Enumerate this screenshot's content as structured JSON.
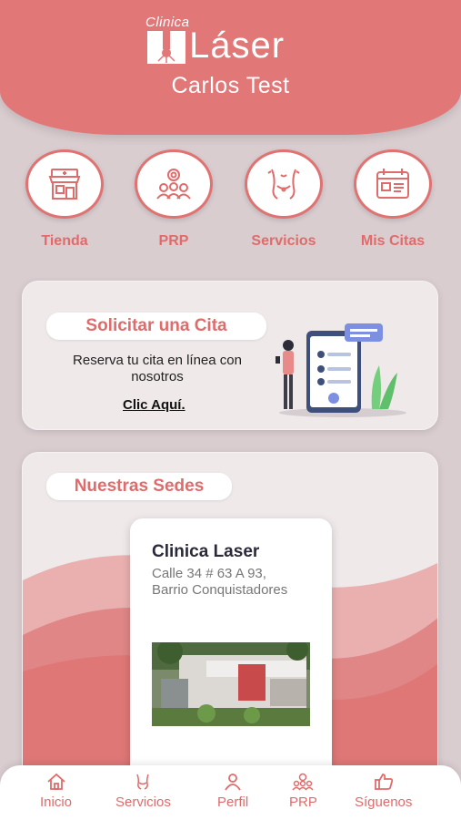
{
  "header": {
    "logo_small": "Clinica",
    "logo_big": "Láser",
    "user_name": "Carlos Test"
  },
  "quick_actions": [
    {
      "label": "Tienda",
      "icon": "store-icon"
    },
    {
      "label": "PRP",
      "icon": "prp-group-icon"
    },
    {
      "label": "Servicios",
      "icon": "body-icon"
    },
    {
      "label": "Mis Citas",
      "icon": "calendar-icon"
    }
  ],
  "appointment": {
    "title": "Solicitar una Cita",
    "description": "Reserva tu cita en línea con nosotros",
    "link": "Clic Aquí."
  },
  "locations": {
    "title": "Nuestras Sedes",
    "items": [
      {
        "name": "Clinica Laser",
        "address": "Calle 34 # 63 A 93, Barrio Conquistadores"
      }
    ]
  },
  "bottom_nav": [
    {
      "label": "Inicio",
      "icon": "home-icon"
    },
    {
      "label": "Servicios",
      "icon": "services-icon"
    },
    {
      "label": "Perfil",
      "icon": "user-icon"
    },
    {
      "label": "PRP",
      "icon": "prp-icon"
    },
    {
      "label": "Síguenos",
      "icon": "thumbs-up-icon"
    }
  ],
  "colors": {
    "brand": "#e27777",
    "background": "#d9cdd0",
    "card": "#efe9ea"
  }
}
